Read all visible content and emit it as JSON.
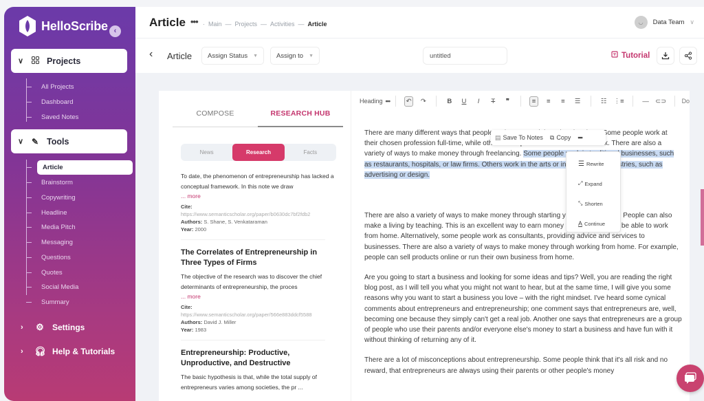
{
  "app": {
    "name": "HelloScribe",
    "collapse_icon": "chevron-left-icon"
  },
  "sidebar": {
    "groups": [
      {
        "label": "Projects",
        "expanded": true,
        "icon": "grid-icon",
        "items": [
          {
            "label": "All Projects"
          },
          {
            "label": "Dashboard"
          },
          {
            "label": "Saved Notes"
          }
        ]
      },
      {
        "label": "Tools",
        "expanded": true,
        "icon": "magic-wand-icon",
        "items": [
          {
            "label": "Article",
            "active": true
          },
          {
            "label": "Brainstorm"
          },
          {
            "label": "Copywriting"
          },
          {
            "label": "Headline"
          },
          {
            "label": "Media Pitch"
          },
          {
            "label": "Messaging"
          },
          {
            "label": "Questions"
          },
          {
            "label": "Quotes"
          },
          {
            "label": "Social Media"
          },
          {
            "label": "Summary"
          }
        ]
      }
    ],
    "bottom": [
      {
        "label": "Settings",
        "icon": "gear-icon"
      },
      {
        "label": "Help & Tutorials",
        "icon": "headset-icon"
      }
    ]
  },
  "header": {
    "title": "Article",
    "more": "•••",
    "breadcrumb": [
      "Main",
      "Projects",
      "Activities",
      "Article"
    ],
    "user": {
      "name": "Data Team",
      "avatar": "smiley-avatar"
    }
  },
  "toolbar": {
    "back_label": "Article",
    "assign_status": "Assign Status",
    "assign_to": "Assign to",
    "document_name": "untitled",
    "tutorial": "Tutorial",
    "download_icon": "download-icon",
    "share_icon": "share-icon"
  },
  "left_panel": {
    "tabs": [
      {
        "label": "COMPOSE",
        "active": false
      },
      {
        "label": "RESEARCH HUB",
        "active": true
      }
    ],
    "segments": [
      {
        "label": "News",
        "active": false
      },
      {
        "label": "Research",
        "active": true
      },
      {
        "label": "Facts",
        "active": false
      }
    ],
    "labels": {
      "cite": "Cite:",
      "authors": "Authors:",
      "year": "Year:",
      "more": "... more"
    },
    "results": [
      {
        "title": "",
        "snippet": "To date, the phenomenon of entrepreneurship has lacked a conceptual framework. In this note we draw",
        "cite": "https://www.semanticscholar.org/paper/b0630dc7bf2fdb2",
        "authors": "S. Shane, S. Venkataraman",
        "year": "2000"
      },
      {
        "title": "The Correlates of Entrepreneurship in Three Types of Firms",
        "snippet": "The objective of the research was to discover the chief determinants of entrepreneurship, the proces",
        "cite": "https://www.semanticscholar.org/paper/566e883ddcf5588",
        "authors": "David J. Miller",
        "year": "1983"
      },
      {
        "title": "Entrepreneurship: Productive, Unproductive, and Destructive",
        "snippet": "The basic hypothesis is that, while the total supply of entrepreneurs varies among societies, the pr ..."
      }
    ]
  },
  "editor_toolbar": {
    "heading": "Heading",
    "more": "•••",
    "buttons": [
      "undo",
      "redo",
      "bold",
      "underline",
      "italic",
      "strikethrough",
      "quote",
      "align-left",
      "align-center",
      "align-right",
      "align-justify",
      "bullet-list",
      "numbered-list",
      "horizontal-rule",
      "link"
    ],
    "overflow_label": "Do"
  },
  "editor": {
    "p1_before": "There are many different ways that people make money doing what they love. Some people work at their chosen profession full-time, while others work part-time or do contract work. There are also a variety of ways to make money through freelancing. ",
    "p1_selected": "Some people work in traditional businesses, such as restaurants, hospitals, or law firms. Others work in the arts or in the creative industries, such as advertising or design.",
    "p2": "There are also a variety of ways to make money through starting your own business. People can also make a living by teaching. This is an excellent way to earn money from home and to be able to work from home. Alternatively, some people work as consultants, providing advice and services to businesses. There are also a variety of ways to make money through working from home. For example, people can sell products online or run their own business from home.",
    "p3": "Are you going to start a business and looking for some ideas and tips? Well, you are reading the right blog post, as I will tell you what you might not want to hear, but at the same time, I will give you some reasons why you want to start a business you love – with the right mindset. I've heard some cynical comments about entrepreneurs and entrepreneurship; one comment says that entrepreneurs are, well, becoming one because they simply can't get a real job. Another one says that entrepreneurs are a group of people who use their parents and/or everyone else's money to start a business and have fun with it without thinking of returning any of it.",
    "p4": "There are a lot of misconceptions about entrepreneurship. Some people think that it's all risk and no reward, that entrepreneurs are always using their parents or other people's money"
  },
  "selection_menu": {
    "save_to_notes": "Save To Notes",
    "copy": "Copy",
    "more": "•••",
    "ai_actions": [
      {
        "label": "Rewrite",
        "icon": "rewrite-icon"
      },
      {
        "label": "Expand",
        "icon": "expand-icon"
      },
      {
        "label": "Shorten",
        "icon": "shorten-icon"
      },
      {
        "label": "Continue",
        "icon": "continue-icon"
      }
    ]
  },
  "colors": {
    "accent": "#c4366e",
    "segment_active": "#d63a6a",
    "sidebar_top": "#6b3aa9",
    "sidebar_bottom": "#b83b74",
    "selection": "#c9dbf3"
  }
}
